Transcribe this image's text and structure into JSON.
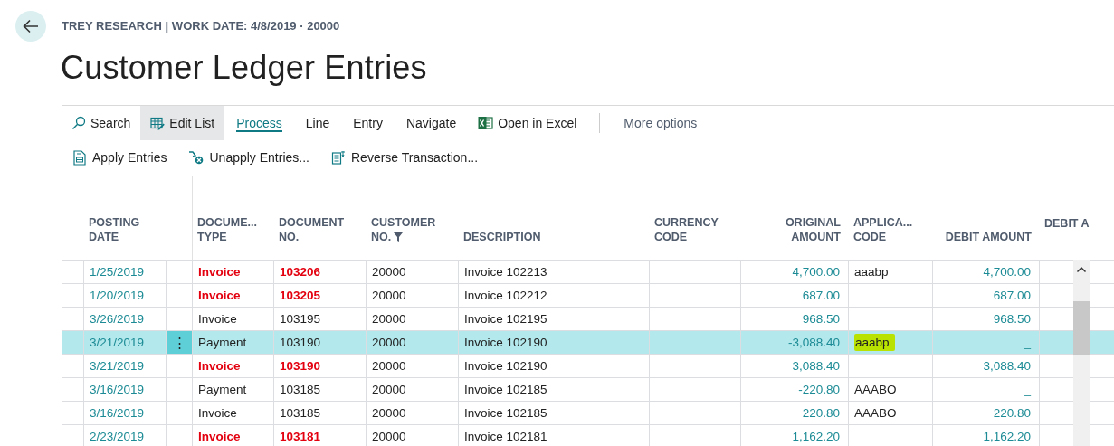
{
  "header": {
    "breadcrumb": "TREY RESEARCH | WORK DATE: 4/8/2019 · 20000",
    "title": "Customer Ledger Entries"
  },
  "actions": [
    {
      "label": "Search",
      "kind": "command",
      "selected": false,
      "highlighted": false
    },
    {
      "label": "Edit List",
      "kind": "command",
      "selected": false,
      "highlighted": true
    },
    {
      "label": "Process",
      "kind": "menu",
      "selected": true,
      "highlighted": false
    },
    {
      "label": "Line",
      "kind": "menu",
      "selected": false,
      "highlighted": false
    },
    {
      "label": "Entry",
      "kind": "menu",
      "selected": false,
      "highlighted": false
    },
    {
      "label": "Navigate",
      "kind": "menu",
      "selected": false,
      "highlighted": false
    },
    {
      "label": "Open in Excel",
      "kind": "command",
      "selected": false,
      "highlighted": false
    },
    {
      "label": "More options",
      "kind": "overflow",
      "selected": false,
      "highlighted": false
    }
  ],
  "sub_actions": [
    {
      "label": "Apply Entries"
    },
    {
      "label": "Unapply Entries..."
    },
    {
      "label": "Reverse Transaction..."
    }
  ],
  "table": {
    "row_menu_glyph": "⋮",
    "columns": [
      {
        "label": "POSTING\nDATE",
        "filtered": false
      },
      {
        "label": "DOCUME...\nTYPE",
        "filtered": false
      },
      {
        "label": "DOCUMENT\nNO.",
        "filtered": false
      },
      {
        "label": "CUSTOMER\nNO.",
        "filtered": true
      },
      {
        "label": "DESCRIPTION",
        "filtered": false
      },
      {
        "label": "CURRENCY\nCODE",
        "filtered": false
      },
      {
        "label": "ORIGINAL\nAMOUNT",
        "filtered": false
      },
      {
        "label": "APPLICA...\nCODE",
        "filtered": false
      },
      {
        "label": "DEBIT AMOUNT",
        "filtered": false
      },
      {
        "label": "DEBIT A",
        "filtered": false
      }
    ],
    "rows": [
      {
        "posting_date": "1/25/2019",
        "document_type": "Invoice",
        "document_no": "103206",
        "customer_no": "20000",
        "description": "Invoice 102213",
        "original_amount": "4,700.00",
        "applies_code": "aaabp",
        "debit_amount": "4,700.00",
        "emphasized": true,
        "selected": false
      },
      {
        "posting_date": "1/20/2019",
        "document_type": "Invoice",
        "document_no": "103205",
        "customer_no": "20000",
        "description": "Invoice 102212",
        "original_amount": "687.00",
        "debit_amount": "687.00",
        "emphasized": true,
        "selected": false
      },
      {
        "posting_date": "3/26/2019",
        "document_type": "Invoice",
        "document_no": "103195",
        "customer_no": "20000",
        "description": "Invoice 102195",
        "original_amount": "968.50",
        "debit_amount": "968.50",
        "emphasized": false,
        "selected": false
      },
      {
        "posting_date": "3/21/2019",
        "document_type": "Payment",
        "document_no": "103190",
        "customer_no": "20000",
        "description": "Invoice 102190",
        "original_amount": "-3,088.40",
        "applies_code": "aaabp",
        "debit_amount": "_",
        "emphasized": false,
        "selected": true,
        "highlighted": true
      },
      {
        "posting_date": "3/21/2019",
        "document_type": "Invoice",
        "document_no": "103190",
        "customer_no": "20000",
        "description": "Invoice 102190",
        "original_amount": "3,088.40",
        "debit_amount": "3,088.40",
        "emphasized": true,
        "selected": false
      },
      {
        "posting_date": "3/16/2019",
        "document_type": "Payment",
        "document_no": "103185",
        "customer_no": "20000",
        "description": "Invoice 102185",
        "original_amount": "-220.80",
        "applies_code": "AAABO",
        "debit_amount": "_",
        "emphasized": false,
        "selected": false
      },
      {
        "posting_date": "3/16/2019",
        "document_type": "Invoice",
        "document_no": "103185",
        "customer_no": "20000",
        "description": "Invoice 102185",
        "original_amount": "220.80",
        "applies_code": "AAABO",
        "debit_amount": "220.80",
        "emphasized": false,
        "selected": false
      },
      {
        "posting_date": "2/23/2019",
        "document_type": "Invoice",
        "document_no": "103181",
        "customer_no": "20000",
        "description": "Invoice 102181",
        "original_amount": "1,162.20",
        "debit_amount": "1,162.20",
        "emphasized": true,
        "selected": false
      }
    ]
  }
}
